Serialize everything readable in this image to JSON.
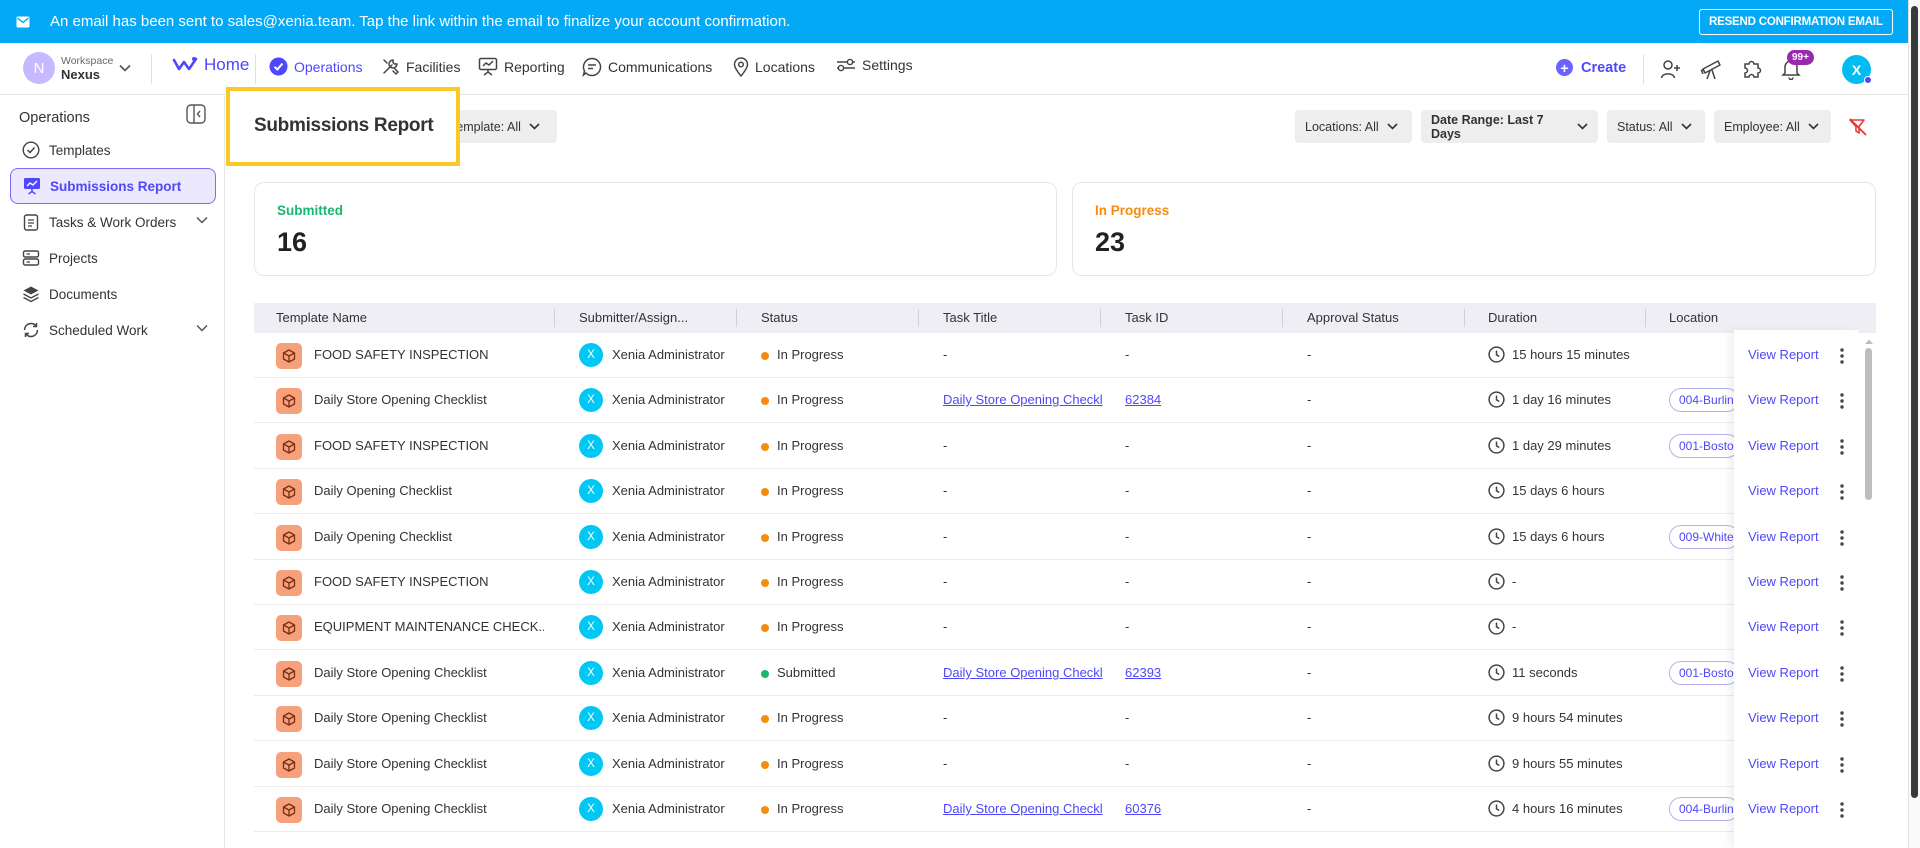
{
  "banner": {
    "message": "An email has been sent to sales@xenia.team. Tap the link within the email to finalize your account confirmation.",
    "resend_label": "RESEND CONFIRMATION EMAIL"
  },
  "workspace": {
    "initial": "N",
    "label": "Workspace",
    "name": "Nexus"
  },
  "nav": {
    "home": "Home",
    "operations": "Operations",
    "facilities": "Facilities",
    "reporting": "Reporting",
    "communications": "Communications",
    "locations": "Locations",
    "settings": "Settings",
    "create": "Create",
    "notifications_badge": "99+",
    "user_initial": "X"
  },
  "sidebar": {
    "heading": "Operations",
    "items": [
      {
        "label": "Templates"
      },
      {
        "label": "Submissions Report"
      },
      {
        "label": "Tasks & Work Orders"
      },
      {
        "label": "Projects"
      },
      {
        "label": "Documents"
      },
      {
        "label": "Scheduled Work"
      }
    ]
  },
  "page": {
    "title": "Submissions Report",
    "filters": {
      "template": "Template: All",
      "locations": "Locations: All",
      "date_range": "Date Range: Last 7 Days",
      "status": "Status: All",
      "employee": "Employee: All"
    }
  },
  "summary": {
    "submitted": {
      "label": "Submitted",
      "value": "16"
    },
    "in_progress": {
      "label": "In Progress",
      "value": "23"
    }
  },
  "table": {
    "columns": [
      "Template Name",
      "Submitter/Assign...",
      "Status",
      "Task Title",
      "Task ID",
      "Approval Status",
      "Duration",
      "Location"
    ],
    "action_label": "View Report",
    "rows": [
      {
        "template": "FOOD SAFETY INSPECTION",
        "submitter": "Xenia Administrator",
        "avatar": "X",
        "status": "In Progress",
        "task_title": "-",
        "task_id": "-",
        "approval": "-",
        "duration": "15 hours 15 minutes",
        "location": ""
      },
      {
        "template": "Daily Store Opening Checklist",
        "submitter": "Xenia Administrator",
        "avatar": "X",
        "status": "In Progress",
        "task_title": "Daily Store Opening Checkl",
        "task_id": "62384",
        "approval": "-",
        "duration": "1 day 16 minutes",
        "location": "004-Burlin"
      },
      {
        "template": "FOOD SAFETY INSPECTION",
        "submitter": "Xenia Administrator",
        "avatar": "X",
        "status": "In Progress",
        "task_title": "-",
        "task_id": "-",
        "approval": "-",
        "duration": "1 day 29 minutes",
        "location": "001-Bosto"
      },
      {
        "template": "Daily Opening Checklist",
        "submitter": "Xenia Administrator",
        "avatar": "X",
        "status": "In Progress",
        "task_title": "-",
        "task_id": "-",
        "approval": "-",
        "duration": "15 days 6 hours",
        "location": ""
      },
      {
        "template": "Daily Opening Checklist",
        "submitter": "Xenia Administrator",
        "avatar": "X",
        "status": "In Progress",
        "task_title": "-",
        "task_id": "-",
        "approval": "-",
        "duration": "15 days 6 hours",
        "location": "009-White"
      },
      {
        "template": "FOOD SAFETY INSPECTION",
        "submitter": "Xenia Administrator",
        "avatar": "X",
        "status": "In Progress",
        "task_title": "-",
        "task_id": "-",
        "approval": "-",
        "duration": "-",
        "location": ""
      },
      {
        "template": "EQUIPMENT MAINTENANCE CHECK...",
        "submitter": "Xenia Administrator",
        "avatar": "X",
        "status": "In Progress",
        "task_title": "-",
        "task_id": "-",
        "approval": "-",
        "duration": "-",
        "location": ""
      },
      {
        "template": "Daily Store Opening Checklist",
        "submitter": "Xenia Administrator",
        "avatar": "X",
        "status": "Submitted",
        "task_title": "Daily Store Opening Checkl",
        "task_id": "62393",
        "approval": "-",
        "duration": "11 seconds",
        "location": "001-Bosto"
      },
      {
        "template": "Daily Store Opening Checklist",
        "submitter": "Xenia Administrator",
        "avatar": "X",
        "status": "In Progress",
        "task_title": "-",
        "task_id": "-",
        "approval": "-",
        "duration": "9 hours 54 minutes",
        "location": ""
      },
      {
        "template": "Daily Store Opening Checklist",
        "submitter": "Xenia Administrator",
        "avatar": "X",
        "status": "In Progress",
        "task_title": "-",
        "task_id": "-",
        "approval": "-",
        "duration": "9 hours 55 minutes",
        "location": ""
      },
      {
        "template": "Daily Store Opening Checklist",
        "submitter": "Xenia Administrator",
        "avatar": "X",
        "status": "In Progress",
        "task_title": "Daily Store Opening Checkl",
        "task_id": "60376",
        "approval": "-",
        "duration": "4 hours 16 minutes",
        "location": "004-Burlin"
      }
    ]
  },
  "colors": {
    "banner": "#03a9f4",
    "accent": "#4e48fa",
    "in_progress": "#f58d0b",
    "submitted": "#1cb670",
    "highlight": "#fbc926"
  }
}
